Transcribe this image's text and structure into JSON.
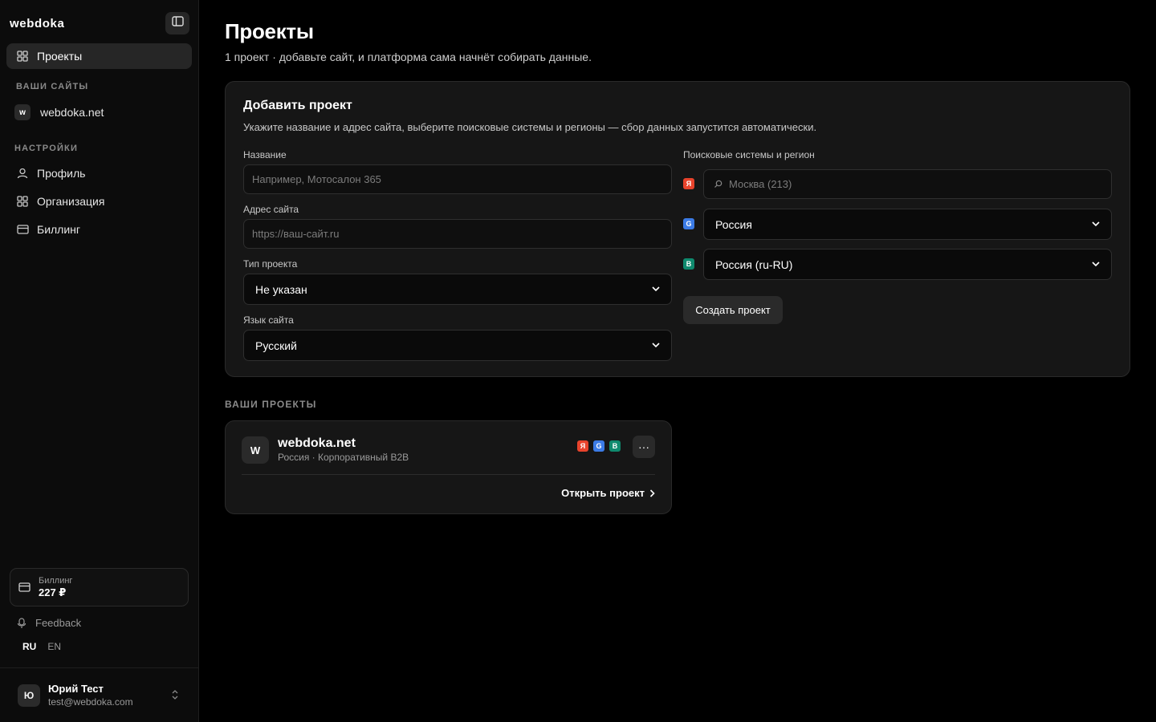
{
  "sidebar": {
    "brand": "webdoka",
    "nav_projects": "Проекты",
    "sites_label": "ВАШИ САЙТЫ",
    "site": {
      "badge": "w",
      "name": "webdoka.net"
    },
    "settings_label": "НАСТРОЙКИ",
    "settings_items": [
      {
        "label": "Профиль",
        "icon": "user-icon"
      },
      {
        "label": "Организация",
        "icon": "grid-icon"
      },
      {
        "label": "Биллинг",
        "icon": "card-icon"
      }
    ],
    "billing": {
      "label": "Биллинг",
      "value": "227 ₽"
    },
    "feedback": "Feedback",
    "lang": {
      "active": "RU",
      "other": "EN"
    },
    "user": {
      "initial": "Ю",
      "name": "Юрий Тест",
      "email": "test@webdoka.com"
    }
  },
  "main": {
    "title": "Проекты",
    "subtitle": "1 проект · добавьте сайт, и платформа сама начнёт собирать данные.",
    "add_project": {
      "title": "Добавить проект",
      "description": "Укажите название и адрес сайта, выберите поисковые системы и регионы — сбор данных запустится автоматически.",
      "name_label": "Название",
      "name_placeholder": "Например, Мотосалон 365",
      "url_label": "Адрес сайта",
      "url_placeholder": "https://ваш-сайт.ru",
      "type_label": "Тип проекта",
      "type_value": "Не указан",
      "lang_label": "Язык сайта",
      "lang_value": "Русский",
      "engines_label": "Поисковые системы и регион",
      "yandex_badge": "Я",
      "yandex_placeholder": "Москва (213)",
      "google_badge": "G",
      "google_value": "Россия",
      "bing_badge": "B",
      "bing_value": "Россия (ru-RU)",
      "create_button": "Создать проект"
    },
    "projects_label": "ВАШИ ПРОЕКТЫ",
    "project": {
      "initial": "W",
      "name": "webdoka.net",
      "meta": "Россия · Корпоративный B2B",
      "badges": [
        "Я",
        "G",
        "B"
      ],
      "more": "···",
      "open_link": "Открыть проект"
    }
  },
  "colors": {
    "yandex": "#e8432c",
    "google": "#3b7be6",
    "bing": "#0f8a6e",
    "background": "#000000",
    "sidebar": "#0c0c0c",
    "card": "#161616"
  }
}
